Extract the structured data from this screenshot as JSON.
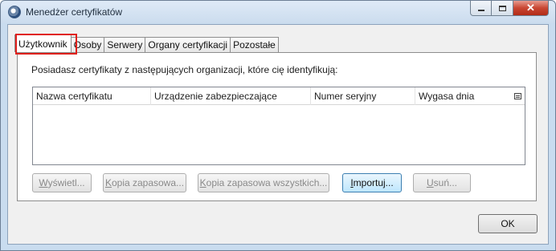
{
  "window": {
    "title": "Menedżer certyfikatów",
    "icon": "certificate-app-icon",
    "controls": {
      "close": "✕"
    }
  },
  "tabs": [
    {
      "label": "Użytkownik",
      "active": true
    },
    {
      "label": "Osoby",
      "active": false
    },
    {
      "label": "Serwery",
      "active": false
    },
    {
      "label": "Organy certyfikacji",
      "active": false
    },
    {
      "label": "Pozostałe",
      "active": false
    }
  ],
  "panel": {
    "description": "Posiadasz certyfikaty z następujących organizacji, które cię identyfikują:",
    "columns": [
      "Nazwa certyfikatu",
      "Urządzenie zabezpieczające",
      "Numer seryjny",
      "Wygasa dnia"
    ],
    "rows": []
  },
  "buttons": {
    "view": {
      "label": "Wyświetl...",
      "enabled": false
    },
    "backup": {
      "label": "Kopia zapasowa...",
      "enabled": false
    },
    "backup_all": {
      "label": "Kopia zapasowa wszystkich...",
      "enabled": false
    },
    "import": {
      "label": "Importuj...",
      "enabled": true
    },
    "delete": {
      "label": "Usuń...",
      "enabled": false
    }
  },
  "ok": {
    "label": "OK"
  },
  "colors": {
    "highlight": "#e0201c",
    "hover_border": "#3c7fb1",
    "window_frame": "#c9dcef"
  }
}
